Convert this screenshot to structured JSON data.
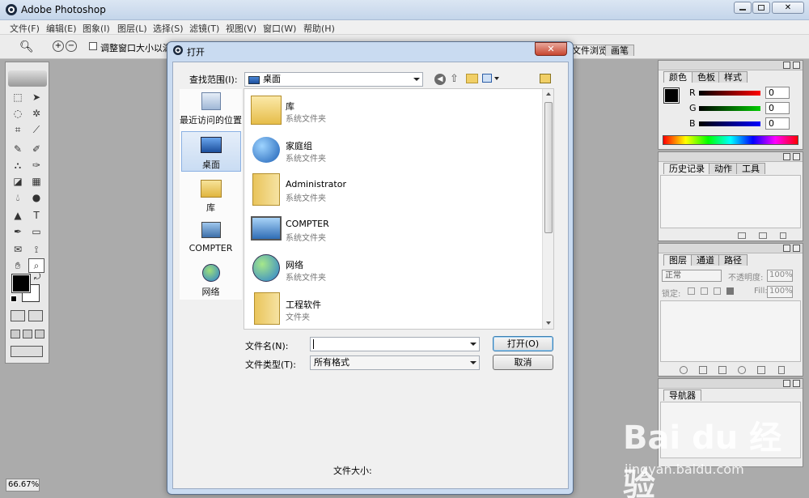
{
  "app": {
    "title": "Adobe Photoshop"
  },
  "menu": [
    "文件(F)",
    "编辑(E)",
    "图象(I)",
    "图层(L)",
    "选择(S)",
    "滤镜(T)",
    "视图(V)",
    "窗口(W)",
    "帮助(H)"
  ],
  "options": {
    "checkbox_label": "调整窗口大小以满"
  },
  "palette_tabs": {
    "file_browser": "文件浏览",
    "brushes": "画笔"
  },
  "panels": {
    "color": {
      "tabs": [
        "颜色",
        "色板",
        "样式"
      ],
      "channels": [
        {
          "label": "R",
          "value": "0"
        },
        {
          "label": "G",
          "value": "0"
        },
        {
          "label": "B",
          "value": "0"
        }
      ]
    },
    "history": {
      "tabs": [
        "历史记录",
        "动作",
        "工具"
      ]
    },
    "layers": {
      "tabs": [
        "图层",
        "通道",
        "路径"
      ],
      "blend_mode": "正常",
      "opacity_label": "不透明度:",
      "opacity_value": "100%",
      "lock_label": "锁定:",
      "fill_label": "Fill:",
      "fill_value": "100%"
    },
    "navigator": {
      "tabs": [
        "导航器"
      ]
    }
  },
  "status": {
    "zoom": "66.67%"
  },
  "dialog": {
    "title": "打开",
    "close": "✕",
    "look_in_label": "查找范围(I):",
    "look_in_value": "桌面",
    "places": [
      {
        "label": "最近访问的位置",
        "icon": "recent-places-icon"
      },
      {
        "label": "桌面",
        "icon": "desktop-icon"
      },
      {
        "label": "库",
        "icon": "library-icon"
      },
      {
        "label": "COMPTER",
        "icon": "computer-icon"
      },
      {
        "label": "网络",
        "icon": "network-icon"
      }
    ],
    "files": [
      {
        "name": "库",
        "type": "系统文件夹",
        "icon": "library-folder-icon"
      },
      {
        "name": "家庭组",
        "type": "系统文件夹",
        "icon": "homegroup-icon"
      },
      {
        "name": "Administrator",
        "type": "系统文件夹",
        "icon": "user-folder-icon"
      },
      {
        "name": "COMPTER",
        "type": "系统文件夹",
        "icon": "computer-icon"
      },
      {
        "name": "网络",
        "type": "系统文件夹",
        "icon": "network-icon"
      },
      {
        "name": "工程软件",
        "type": "文件夹",
        "icon": "folder-icon"
      }
    ],
    "filename_label": "文件名(N):",
    "filename_value": "",
    "filetype_label": "文件类型(T):",
    "filetype_value": "所有格式",
    "open_button": "打开(O)",
    "cancel_button": "取消",
    "filesize_label": "文件大小:"
  },
  "watermark": {
    "brand": "Bai du 经验",
    "url": "jingyan.baidu.com"
  }
}
